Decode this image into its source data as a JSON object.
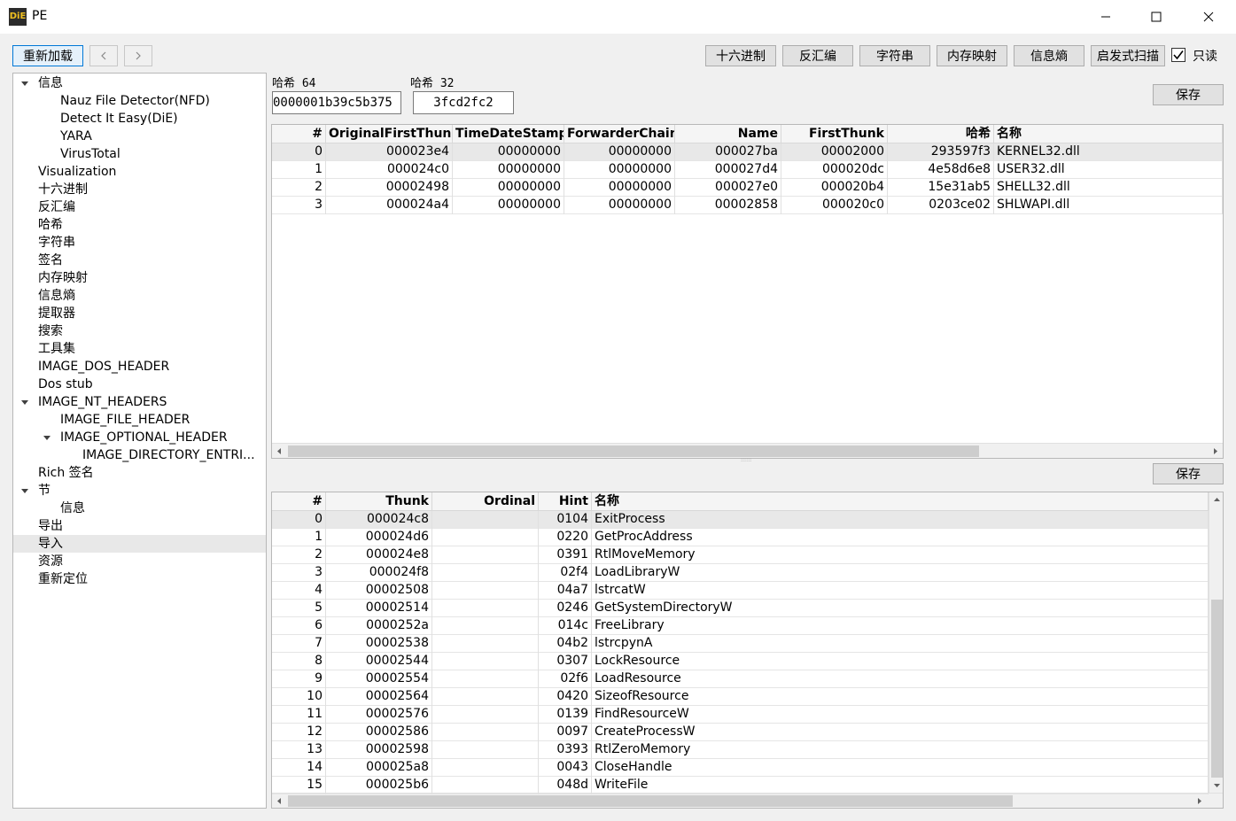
{
  "window": {
    "title": "PE",
    "icon_label": "DiE"
  },
  "toolbar": {
    "reload": "重新加载",
    "right_buttons": [
      "十六进制",
      "反汇编",
      "字符串",
      "内存映射",
      "信息熵",
      "启发式扫描"
    ],
    "readonly_label": "只读",
    "readonly_checked": true
  },
  "tree": [
    {
      "label": "信息",
      "level": 0,
      "expanded": true
    },
    {
      "label": "Nauz File Detector(NFD)",
      "level": 1
    },
    {
      "label": "Detect It Easy(DiE)",
      "level": 1
    },
    {
      "label": "YARA",
      "level": 1
    },
    {
      "label": "VirusTotal",
      "level": 1
    },
    {
      "label": "Visualization",
      "level": 0
    },
    {
      "label": "十六进制",
      "level": 0
    },
    {
      "label": "反汇编",
      "level": 0
    },
    {
      "label": "哈希",
      "level": 0
    },
    {
      "label": "字符串",
      "level": 0
    },
    {
      "label": "签名",
      "level": 0
    },
    {
      "label": "内存映射",
      "level": 0
    },
    {
      "label": "信息熵",
      "level": 0
    },
    {
      "label": "提取器",
      "level": 0
    },
    {
      "label": "搜索",
      "level": 0
    },
    {
      "label": "工具集",
      "level": 0
    },
    {
      "label": "IMAGE_DOS_HEADER",
      "level": 0
    },
    {
      "label": "Dos stub",
      "level": 0
    },
    {
      "label": "IMAGE_NT_HEADERS",
      "level": 0,
      "expanded": true
    },
    {
      "label": "IMAGE_FILE_HEADER",
      "level": 1
    },
    {
      "label": "IMAGE_OPTIONAL_HEADER",
      "level": 1,
      "expanded": true
    },
    {
      "label": "IMAGE_DIRECTORY_ENTRI...",
      "level": 2
    },
    {
      "label": "Rich 签名",
      "level": 0
    },
    {
      "label": "节",
      "level": 0,
      "expanded": true
    },
    {
      "label": "信息",
      "level": 1
    },
    {
      "label": "导出",
      "level": 0
    },
    {
      "label": "导入",
      "level": 0,
      "selected": true
    },
    {
      "label": "资源",
      "level": 0
    },
    {
      "label": "重新定位",
      "level": 0
    }
  ],
  "hash": {
    "hash64_label": "哈希 64",
    "hash64_value": "0000001b39c5b375",
    "hash32_label": "哈希 32",
    "hash32_value": "3fcd2fc2",
    "save": "保存"
  },
  "imports_table": {
    "headers": [
      "#",
      "OriginalFirstThunk",
      "TimeDateStamp",
      "ForwarderChain",
      "Name",
      "FirstThunk",
      "哈希",
      "名称"
    ],
    "rows": [
      [
        "0",
        "000023e4",
        "00000000",
        "00000000",
        "000027ba",
        "00002000",
        "293597f3",
        "KERNEL32.dll"
      ],
      [
        "1",
        "000024c0",
        "00000000",
        "00000000",
        "000027d4",
        "000020dc",
        "4e58d6e8",
        "USER32.dll"
      ],
      [
        "2",
        "00002498",
        "00000000",
        "00000000",
        "000027e0",
        "000020b4",
        "15e31ab5",
        "SHELL32.dll"
      ],
      [
        "3",
        "000024a4",
        "00000000",
        "00000000",
        "00002858",
        "000020c0",
        "0203ce02",
        "SHLWAPI.dll"
      ]
    ]
  },
  "functions": {
    "save": "保存",
    "headers": [
      "#",
      "Thunk",
      "Ordinal",
      "Hint",
      "名称"
    ],
    "rows": [
      [
        "0",
        "000024c8",
        "",
        "0104",
        "ExitProcess"
      ],
      [
        "1",
        "000024d6",
        "",
        "0220",
        "GetProcAddress"
      ],
      [
        "2",
        "000024e8",
        "",
        "0391",
        "RtlMoveMemory"
      ],
      [
        "3",
        "000024f8",
        "",
        "02f4",
        "LoadLibraryW"
      ],
      [
        "4",
        "00002508",
        "",
        "04a7",
        "lstrcatW"
      ],
      [
        "5",
        "00002514",
        "",
        "0246",
        "GetSystemDirectoryW"
      ],
      [
        "6",
        "0000252a",
        "",
        "014c",
        "FreeLibrary"
      ],
      [
        "7",
        "00002538",
        "",
        "04b2",
        "lstrcpynA"
      ],
      [
        "8",
        "00002544",
        "",
        "0307",
        "LockResource"
      ],
      [
        "9",
        "00002554",
        "",
        "02f6",
        "LoadResource"
      ],
      [
        "10",
        "00002564",
        "",
        "0420",
        "SizeofResource"
      ],
      [
        "11",
        "00002576",
        "",
        "0139",
        "FindResourceW"
      ],
      [
        "12",
        "00002586",
        "",
        "0097",
        "CreateProcessW"
      ],
      [
        "13",
        "00002598",
        "",
        "0393",
        "RtlZeroMemory"
      ],
      [
        "14",
        "000025a8",
        "",
        "0043",
        "CloseHandle"
      ],
      [
        "15",
        "000025b6",
        "",
        "048d",
        "WriteFile"
      ]
    ]
  }
}
